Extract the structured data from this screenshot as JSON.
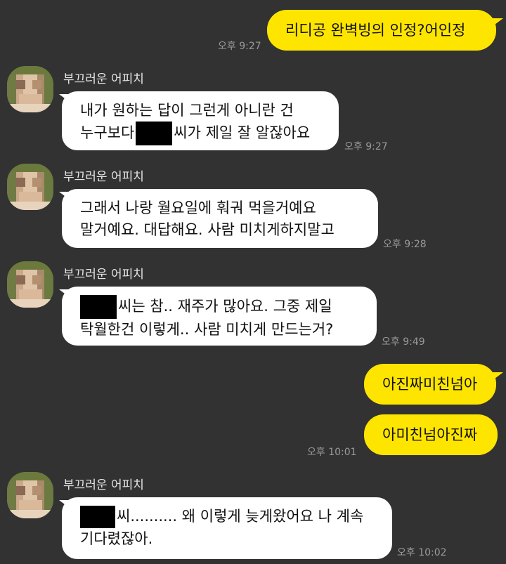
{
  "sender_name": "부끄러운 어피치",
  "messages": [
    {
      "side": "me",
      "text": "리디공 완벽빙의 인정?어인정",
      "time": "오후 9:27"
    },
    {
      "side": "them",
      "line1": "내가 원하는 답이 그런게 아니란 건",
      "line2_pre": "누구보다",
      "line2_post": "씨가 제일 잘 알잖아요",
      "time": "오후 9:27"
    },
    {
      "side": "them",
      "line1": "그래서 나랑 월요일에 훠궈 먹을거예요",
      "line2": "말거예요. 대답해요. 사람 미치게하지말고",
      "time": "오후 9:28"
    },
    {
      "side": "them",
      "line1_post": "씨는 참.. 재주가 많아요. 그중 제일",
      "line2": "탁월한건 이렇게.. 사람 미치게 만드는거?",
      "time": "오후 9:49"
    },
    {
      "side": "me",
      "text": "아진짜미친넘아"
    },
    {
      "side": "me",
      "text": "아미친넘아진짜",
      "time": "오후 10:01"
    },
    {
      "side": "them",
      "line1_post": "씨.......... 왜 이렇게 늦게왔어요 나 계속",
      "line2": "기다렸잖아.",
      "time": "오후 10:02"
    }
  ],
  "colors": {
    "background": "#323232",
    "my_bubble": "#FEE500",
    "their_bubble": "#FFFFFF",
    "timestamp": "#9A9A9A"
  }
}
